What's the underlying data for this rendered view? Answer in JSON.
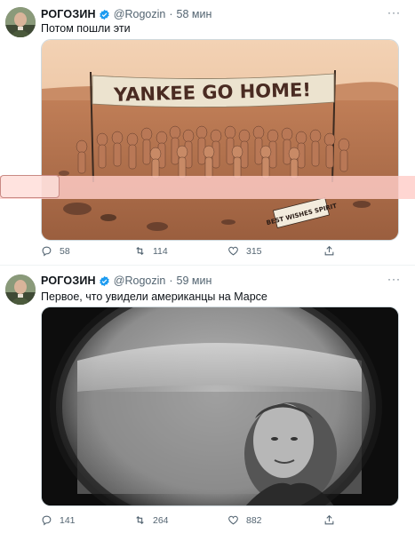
{
  "tweets": [
    {
      "name": "РОГОЗИН",
      "handle": "@Rogozin",
      "dot": "·",
      "time": "58 мин",
      "text": "Потом пошли эти",
      "banner_text": "YANKEE GO HOME!",
      "sign_text": "BEST WISHES SPIRIT",
      "counts": {
        "replies": "58",
        "retweets": "114",
        "likes": "315"
      }
    },
    {
      "name": "РОГОЗИН",
      "handle": "@Rogozin",
      "dot": "·",
      "time": "59 мин",
      "text": "Первое, что увидели американцы на Марсе",
      "counts": {
        "replies": "141",
        "retweets": "264",
        "likes": "882"
      }
    }
  ],
  "icons": {
    "verified": "verified-badge-icon",
    "more": "more-icon",
    "reply": "reply-icon",
    "retweet": "retweet-icon",
    "like": "like-icon",
    "share": "share-icon"
  },
  "colors": {
    "verified": "#1d9bf0",
    "muted": "#536471",
    "text": "#0f1419",
    "overlay": "#ffcdc8"
  },
  "more_glyph": "···"
}
